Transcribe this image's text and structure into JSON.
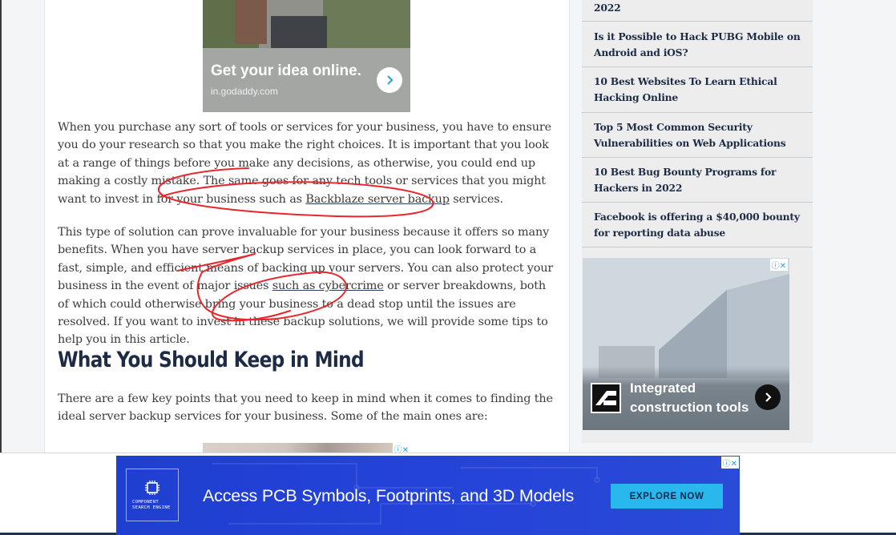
{
  "ad_top": {
    "headline": "Get your idea online.",
    "domain": "in.godaddy.com"
  },
  "article": {
    "p1_part1": "When you purchase any sort of tools or services for your business, you have to ensure you do your research so that you make the right choices. It is important that you look at a range of things before you make any decisions, as otherwise, you could end up making a costly mistake. The same goes for any tech tools or services that you might want to invest in for your business such as ",
    "p1_link": "Backblaze server backup",
    "p1_part2": " services.",
    "p2_part1": "This type of solution can prove invaluable for your business because it offers so many benefits. When you have server backup services in place, you can look forward to a fast, simple, and efficient means of backing up your servers. You can also protect your business in the event of major issues ",
    "p2_link": "such as cybercrime",
    "p2_part2": " or server breakdowns, both of which could otherwise bring your business to a dead stop until the issues are resolved. If you want to invest in these backup solutions, we will provide some tips to help you in this article.",
    "heading": "What You Should Keep in Mind",
    "p3": "There are a few key points that you need to keep in mind when it comes to finding the ideal server backup services for your business. Some of the main ones are:"
  },
  "sidebar": {
    "items": [
      "2022",
      "Is it Possible to Hack PUBG Mobile on Android and iOS?",
      "10 Best Websites To Learn Ethical Hacking Online",
      "Top 5 Most Common Security Vulnerabilities on Web Applications",
      "10 Best Bug Bounty Programs for Hackers in 2022",
      "Facebook is offering a $40,000 bounty for reporting data abuse"
    ]
  },
  "ad_side": {
    "headline": "Integrated construction tools"
  },
  "banner": {
    "brand": "COMPONENT SEARCH ENGINE",
    "headline": "Access PCB Symbols, Footprints, and 3D Models",
    "cta": "EXPLORE NOW"
  },
  "ad_badge": "ⓘ✕",
  "colors": {
    "heading": "#1d2b44",
    "annotation": "#e8262b",
    "banner": "#2443d8",
    "cta": "#28b8ee"
  }
}
